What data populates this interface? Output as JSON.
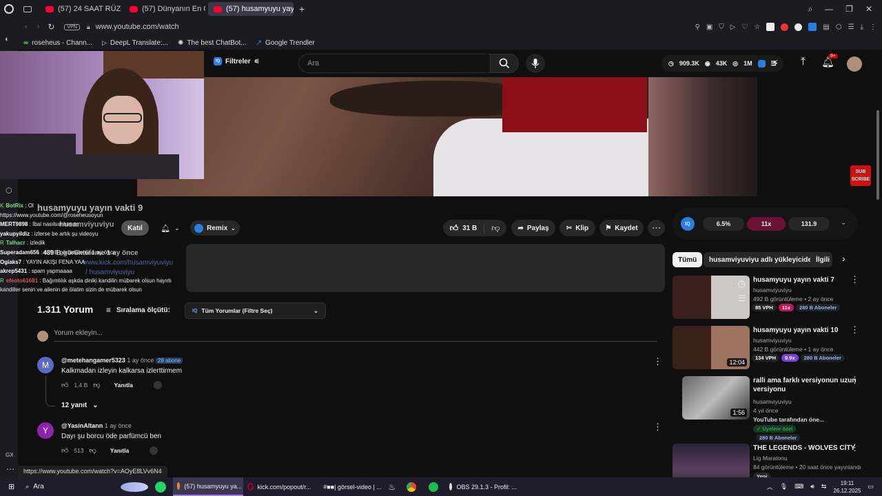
{
  "browser": {
    "tabs": [
      {
        "title": "(57) 24 SAAT RÜZGAR TÜ",
        "active": false
      },
      {
        "title": "(57) Dünyanın En Obez Ş",
        "active": false
      },
      {
        "title": "(57) husamyuyu yayın vak",
        "active": true
      }
    ],
    "address": {
      "vpn_label": "VPN",
      "url": "www.youtube.com/watch"
    },
    "bookmarks": [
      {
        "label": "roseheus - Chann...",
        "icon": "kick-icon"
      },
      {
        "label": "DeepL Translate:...",
        "icon": "deepl-icon"
      },
      {
        "label": "The best ChatBot...",
        "icon": "chatgpt-icon"
      },
      {
        "label": "Google Trendler",
        "icon": "trends-icon"
      }
    ],
    "status_url": "https://www.youtube.com/watch?v=AOyE8LVv6N4",
    "gx_label": "GX"
  },
  "yt_header": {
    "filter_label": "Filtreler",
    "search_placeholder": "Ara",
    "stats": {
      "views": "909.3K",
      "likes": "43K",
      "subs": "1M"
    },
    "notif_badge": "9+"
  },
  "video_overlay": {
    "subscribe_line1": "SUB",
    "subscribe_line2": "SCRIBE"
  },
  "chat": [
    {
      "user": "BotRix",
      "color": "#7ee07e",
      "text": " : Ol",
      "prefix": "K"
    },
    {
      "user": "",
      "color": "#ddd",
      "text": "https://www.youtube.com/@roseheusoyun",
      "prefix": ""
    },
    {
      "user": "MERT9898",
      "color": "#ffffff",
      "text": " : İbal nasılsın hanım",
      "prefix": ""
    },
    {
      "user": "yakupyildiz",
      "color": "#ffffff",
      "text": " : izlerse be artık şu videoyu",
      "prefix": ""
    },
    {
      "user": "Talhacr",
      "color": "#7ee07e",
      "text": " : izledik",
      "prefix": "R"
    },
    {
      "user": "Superadam656",
      "color": "#ffffff",
      "text": " : 489 B görüntüleme  1 ay önce",
      "prefix": ""
    },
    {
      "user": "Ogiaks7",
      "color": "#ffffff",
      "text": " : YAYIN AKIŞI FENA YAA",
      "prefix": ""
    },
    {
      "user": "akrep5431",
      "color": "#ffffff",
      "text": " : spam yapmaaaa",
      "prefix": ""
    },
    {
      "user": "efeoto61681",
      "color": "#e05555",
      "text": " : Bağımlılık aşkda dinlki kandilin mübarek olsun hayırlı",
      "prefix": "R"
    },
    {
      "user": "",
      "color": "#ddd",
      "text": "kandiller senin ve ailenin de ölatim sizin de mübarek olsun",
      "prefix": ""
    }
  ],
  "video": {
    "title": "husamyuyu yayın vakti 9",
    "channel": "husamviyuviyu",
    "join_label": "Katıl",
    "remix_label": "Remix",
    "likes": "31 B",
    "share_label": "Paylaş",
    "clip_label": "Klip",
    "save_label": "Kaydet",
    "desc_views": "489 B görüntüleme  1 ay önce",
    "desc_link": "www.kick.com/husamviyuviyu",
    "desc_link2": "/ husamviyuviyu"
  },
  "stats_panel": {
    "percent": "6.5%",
    "ratio": "11x",
    "score": "131.9"
  },
  "chips": [
    "Tümü",
    "husamviyuviyu adlı yükleyiciden",
    "İlgili"
  ],
  "comments": {
    "count": "1.311 Yorum",
    "sort_label": "Sıralama ölçütü:",
    "filter_label": "Tüm Yorumlar (Filtre Seç)",
    "add_placeholder": "Yorum ekleyin...",
    "items": [
      {
        "author": "@metehangamer5323",
        "time": "1 ay önce",
        "subs": "28 abone",
        "text": "Kalkmadan izleyin kalkarsa izlerttirmem",
        "likes": "1,4 B",
        "reply": "Yanıtla",
        "replies": "12 yanıt",
        "avatar": "M",
        "avatar_color": "#5c6bc0"
      },
      {
        "author": "@YasinAltann",
        "time": "1 ay önce",
        "subs": "",
        "text": "Dayı şu borcu öde parfümcü ben",
        "likes": "513",
        "reply": "Yanıtla",
        "replies": "",
        "avatar": "Y",
        "avatar_color": "#8e24aa"
      }
    ]
  },
  "suggestions": [
    {
      "title": "husamyuyu yayın vakti 7",
      "channel": "husamviyuviyu",
      "meta": "492 B görüntüleme • 2 ay önce",
      "vph": "85 VPH",
      "mult": "11x",
      "mult_color": "#c2185b",
      "subs": "280 B Aboneler",
      "duration": ""
    },
    {
      "title": "husamyuyu yayın vakti 10",
      "channel": "husamviyuviyu",
      "meta": "442 B görüntüleme • 1 ay önce",
      "vph": "134 VPH",
      "mult": "9.9x",
      "mult_color": "#7b3fe4",
      "subs": "280 B Aboneler",
      "duration": "12:04"
    },
    {
      "title": "ralli ama farklı versiyonun uzun versiyonu",
      "channel": "husamviyuviyu",
      "meta": "4 yıl önce",
      "extra": "YouTube tarafından öne...",
      "members": "Üyelere özel",
      "subs": "280 B Aboneler",
      "duration": "1:56"
    },
    {
      "title": "THE LEGENDS - WOLVES CİTY",
      "channel": "Lig Maratonu",
      "meta": "84 görüntüleme • 20 saat önce yayınlandı",
      "badge": "Yeni",
      "duration": ""
    }
  ],
  "taskbar": {
    "search": "Ara",
    "items": [
      "(57) husamyuyu ya...",
      "kick.com/popout/r...",
      "#■■| görsel-video | ...",
      "OBS 29.1.3 - Profil: ..."
    ],
    "time": "19:11",
    "date": "26.12.2025"
  }
}
